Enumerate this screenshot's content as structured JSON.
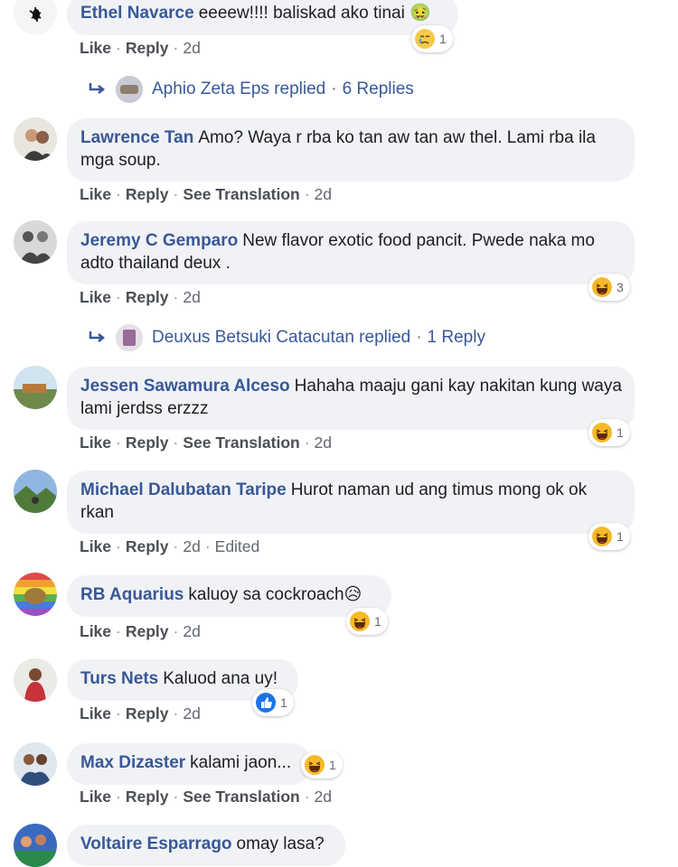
{
  "comments": [
    {
      "author": "Ethel Navarce",
      "text": "eeeew!!!! baliskad ako tinai 🤢",
      "actions": [
        "Like",
        "Reply"
      ],
      "time": "2d",
      "reaction": {
        "icon": "crying-face-icon",
        "count": "1"
      },
      "replies": {
        "name": "Aphio Zeta Eps replied",
        "count": "6 Replies"
      }
    },
    {
      "author": "Lawrence Tan",
      "text": "Amo? Waya r rba ko tan aw tan aw thel. Lami rba ila mga soup.",
      "actions": [
        "Like",
        "Reply",
        "See Translation"
      ],
      "time": "2d"
    },
    {
      "author": "Jeremy C Gemparo",
      "text": "New flavor exotic food pancit. Pwede naka mo adto thailand deux .",
      "actions": [
        "Like",
        "Reply"
      ],
      "time": "2d",
      "reaction": {
        "icon": "haha-icon",
        "count": "3"
      },
      "replies": {
        "name": "Deuxus Betsuki Catacutan replied",
        "count": "1 Reply"
      }
    },
    {
      "author": "Jessen Sawamura Alceso",
      "text": "Hahaha maaju gani kay nakitan kung waya lami jerdss erzzz",
      "actions": [
        "Like",
        "Reply",
        "See Translation"
      ],
      "time": "2d",
      "reaction": {
        "icon": "haha-icon",
        "count": "1"
      }
    },
    {
      "author": "Michael Dalubatan Taripe",
      "text": "Hurot naman ud ang timus mong ok ok rkan",
      "actions": [
        "Like",
        "Reply"
      ],
      "time": "2d",
      "edited": "Edited",
      "reaction": {
        "icon": "haha-icon",
        "count": "1"
      }
    },
    {
      "author": "RB Aquarius",
      "text": "kaluoy sa cockroach😥",
      "actions": [
        "Like",
        "Reply"
      ],
      "time": "2d",
      "reaction": {
        "icon": "haha-icon",
        "count": "1"
      }
    },
    {
      "author": "Turs Nets",
      "text": "Kaluod ana uy!",
      "actions": [
        "Like",
        "Reply"
      ],
      "time": "2d",
      "reaction": {
        "icon": "like-icon",
        "count": "1"
      }
    },
    {
      "author": "Max Dizaster",
      "text": "kalami jaon...",
      "actions": [
        "Like",
        "Reply",
        "See Translation"
      ],
      "time": "2d",
      "reaction": {
        "icon": "haha-icon",
        "count": "1"
      }
    },
    {
      "author": "Voltaire Esparrago",
      "text": "omay lasa?"
    }
  ],
  "colors": {
    "author": "#385898",
    "bubble": "#f0f2f5",
    "action": "#4b4f56",
    "reaction_count": "#65676b"
  }
}
